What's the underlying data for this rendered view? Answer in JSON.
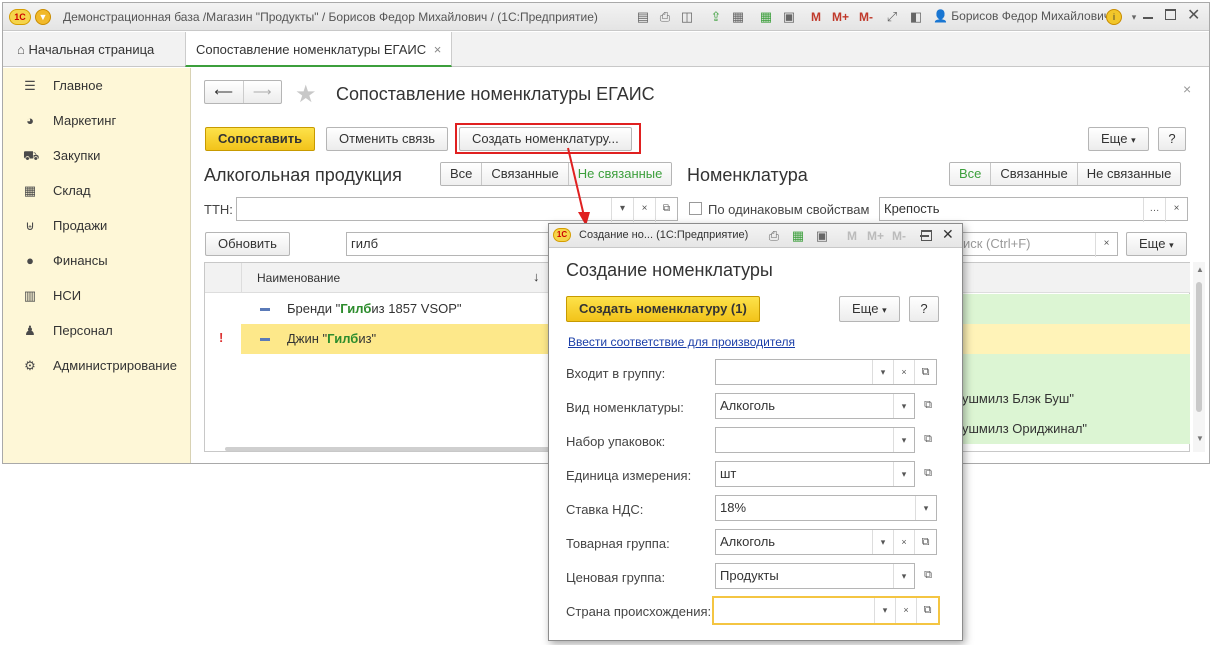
{
  "window": {
    "title": "Демонстрационная база /Магазин \"Продукты\" / Борисов Федор Михайлович /  (1С:Предприятие)",
    "user": "Борисов Федор Михайлович",
    "toolbar_m": "M",
    "toolbar_mplus": "M+",
    "toolbar_mminus": "M-"
  },
  "tabs": [
    {
      "label": "Начальная страница"
    },
    {
      "label": "Сопоставление номенклатуры ЕГАИС"
    }
  ],
  "sidebar": {
    "items": [
      {
        "label": "Главное",
        "icon": "menu-icon"
      },
      {
        "label": "Маркетинг",
        "icon": "pie-chart-icon"
      },
      {
        "label": "Закупки",
        "icon": "cart-icon"
      },
      {
        "label": "Склад",
        "icon": "warehouse-icon"
      },
      {
        "label": "Продажи",
        "icon": "basket-icon"
      },
      {
        "label": "Финансы",
        "icon": "coin-icon"
      },
      {
        "label": "НСИ",
        "icon": "books-icon"
      },
      {
        "label": "Персонал",
        "icon": "person-icon"
      },
      {
        "label": "Администрирование",
        "icon": "gear-icon"
      }
    ]
  },
  "form": {
    "title": "Сопоставление номенклатуры ЕГАИС",
    "btn_match": "Сопоставить",
    "btn_unlink": "Отменить связь",
    "btn_create": "Создать номенклатуру...",
    "btn_more": "Еще",
    "btn_help": "?",
    "left": {
      "header": "Алкогольная продукция",
      "filters": [
        "Все",
        "Связанные",
        "Не связанные"
      ],
      "ttn_label": "ТТН:",
      "ttn_value": "",
      "refresh": "Обновить",
      "search_value": "гилб",
      "col_name": "Наименование",
      "sort_arrow": "↓",
      "rows": [
        {
          "mark": "",
          "prefix": "Бренди \"",
          "hl": "Гилб",
          "suffix": "из 1857 VSOP\""
        },
        {
          "mark": "!",
          "prefix": "Джин \"",
          "hl": "Гилб",
          "suffix": "из\""
        }
      ]
    },
    "right": {
      "header": "Номенклатура",
      "filters": [
        "Все",
        "Связанные",
        "Не связанные"
      ],
      "same_props_label": "По одинаковым свойствам",
      "prop_value": "Крепость",
      "search_placeholder": "иск (Ctrl+F)",
      "btn_more": "Еще",
      "rows": [
        {
          "text": ""
        },
        {
          "text": ""
        },
        {
          "text": ""
        },
        {
          "text": "ушмилз Блэк Буш\""
        },
        {
          "text": "ушмилз Ориджинал\""
        }
      ]
    }
  },
  "dialog": {
    "title": "Создание но...  (1С:Предприятие)",
    "heading": "Создание номенклатуры",
    "btn_create": "Создать номенклатуру (1)",
    "btn_more": "Еще",
    "btn_help": "?",
    "link": "Ввести соответствие для производителя",
    "fields": [
      {
        "label": "Входит в группу:",
        "value": ""
      },
      {
        "label": "Вид номенклатуры:",
        "value": "Алкоголь"
      },
      {
        "label": "Набор упаковок:",
        "value": ""
      },
      {
        "label": "Единица измерения:",
        "value": "шт"
      },
      {
        "label": "Ставка НДС:",
        "value": "18%"
      },
      {
        "label": "Товарная группа:",
        "value": "Алкоголь"
      },
      {
        "label": "Ценовая группа:",
        "value": "Продукты"
      },
      {
        "label": "Страна происхождения:",
        "value": ""
      }
    ]
  },
  "colors": {
    "accent_yellow": "#f2c31a",
    "sidebar_bg": "#fef7d7",
    "green_text": "#3c9f3c",
    "highlight_red": "#e02020"
  }
}
